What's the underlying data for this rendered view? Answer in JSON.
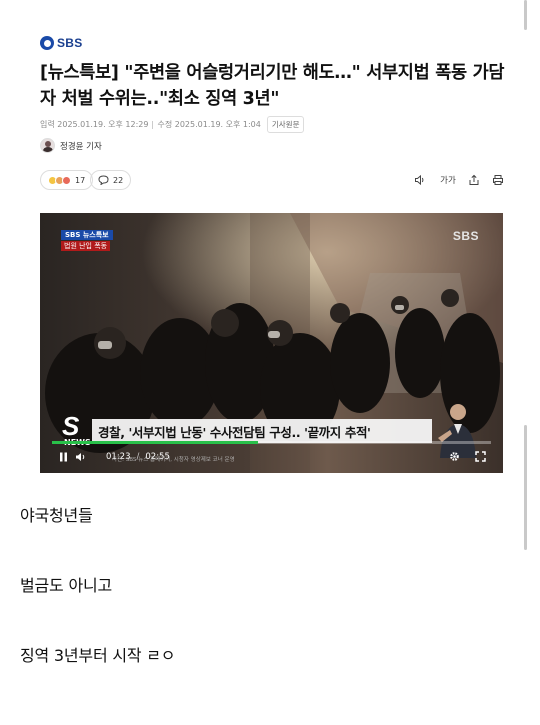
{
  "logo": {
    "text": "SBS"
  },
  "article": {
    "title": "[뉴스특보] \"주변을 어슬렁거리기만 해도…\" 서부지법 폭동 가담자 처벌 수위는..\"최소 징역 3년\"",
    "published": "입력 2025.01.19. 오후 12:29",
    "updated": "수정 2025.01.19. 오후 1:04",
    "original_button": "기사원문",
    "reporter": "정경윤 기자",
    "reaction_count": "17",
    "comment_count": "22",
    "tool_icons": [
      "speaker-icon",
      "font-size-icon",
      "share-icon",
      "print-icon"
    ],
    "font_size_label": "가가"
  },
  "video": {
    "badge_top": "SBS 뉴스특보",
    "badge_bottom": "법원 난입 폭동",
    "watermark": "SBS",
    "caption": "경찰, '서부지법 난동' 수사전담팀 구성.. '끝까지 추적'",
    "logo_s": "S",
    "logo_news": "NEWS",
    "current_time": "01:23",
    "duration": "02:55",
    "progress": 0.47,
    "fine_print": "사진: SBS 뉴스 홈페이지, 시청자 영상제보 코너 운영"
  },
  "comments": [
    "야국청년들",
    "벌금도 아니고",
    "징역 3년부터 시작 ㄹㅇ"
  ]
}
